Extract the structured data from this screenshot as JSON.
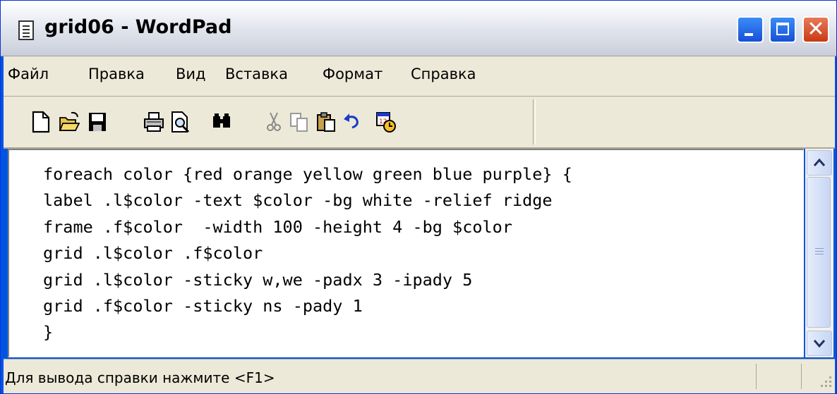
{
  "window": {
    "title": "grid06 - WordPad"
  },
  "menu": [
    "Файл",
    "Правка",
    "Вид",
    "Вставка",
    "Формат",
    "Справка"
  ],
  "toolbar": [
    "new-document-icon",
    "open-folder-icon",
    "save-icon",
    "print-icon",
    "print-preview-icon",
    "find-icon",
    "cut-icon",
    "copy-icon",
    "paste-icon",
    "undo-icon",
    "insert-date-time-icon"
  ],
  "editor": {
    "lines": [
      "foreach color {red orange yellow green blue purple} {",
      "label .l$color -text $color -bg white -relief ridge",
      "frame .f$color  -width 100 -height 4 -bg $color",
      "grid .l$color .f$color",
      "grid .l$color -sticky w,we -padx 3 -ipady 5",
      "grid .f$color -sticky ns -pady 1",
      "}"
    ]
  },
  "status": {
    "text": "Для вывода справки нажмите <F1>"
  },
  "colors": {
    "title_bar_start": "#ffffff",
    "title_bar_end": "#c8cdd7",
    "close_button": "#c83a14",
    "window_buttons": "#1650d8"
  }
}
